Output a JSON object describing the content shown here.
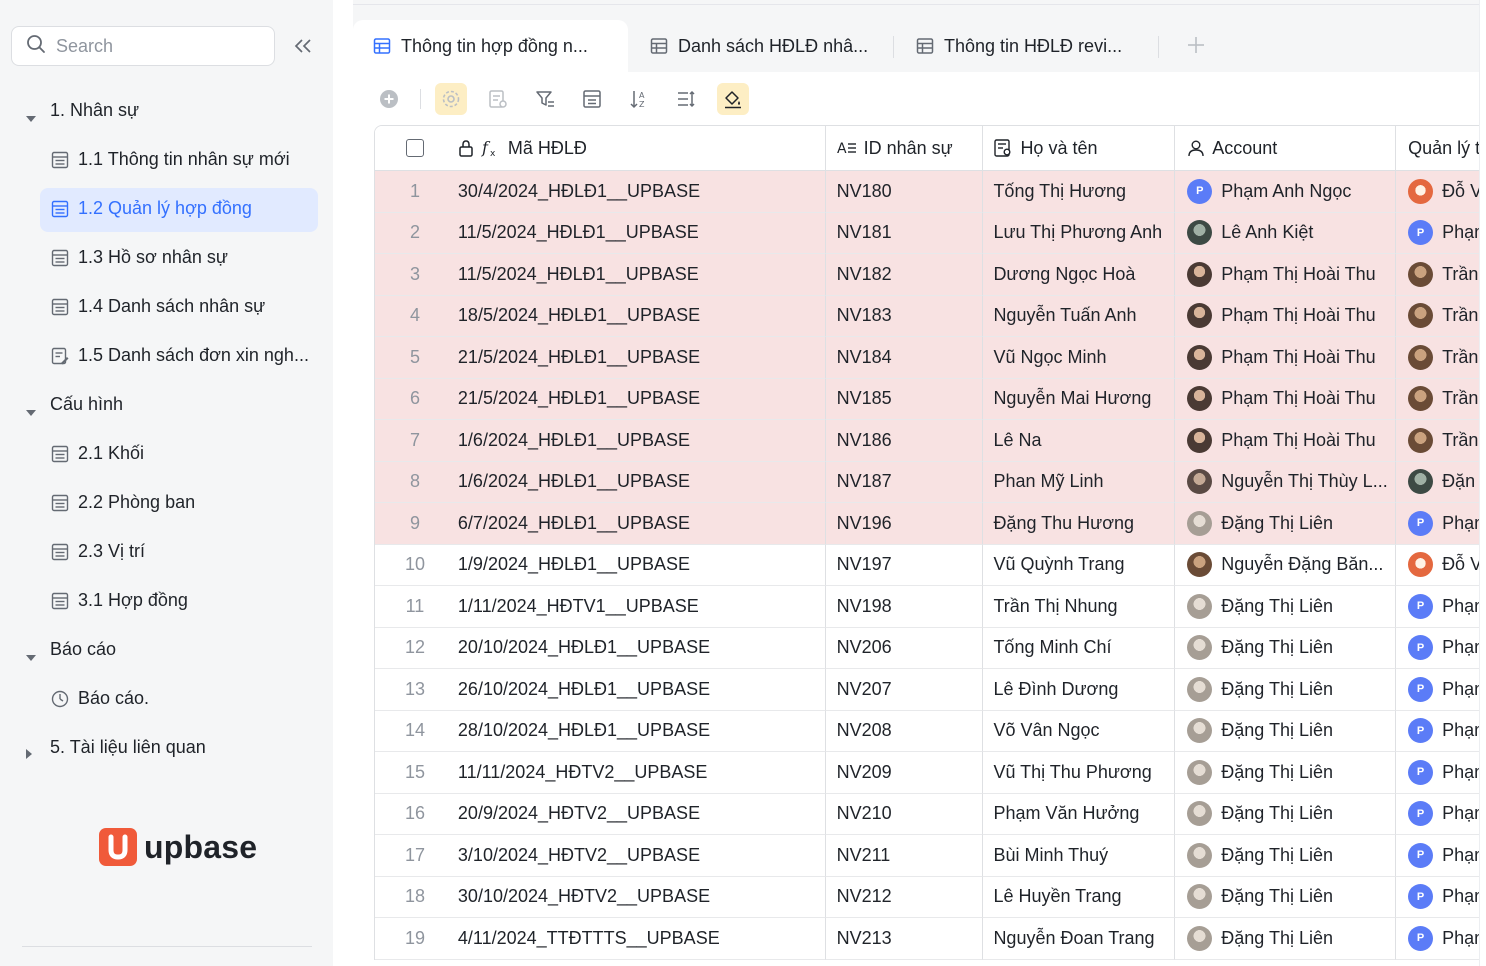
{
  "sidebar": {
    "search_placeholder": "Search",
    "groups": [
      {
        "label": "1. Nhân sự",
        "items": [
          {
            "label": "1.1 Thông tin nhân sự mới",
            "icon": "table-icon"
          },
          {
            "label": "1.2 Quản lý hợp đồng",
            "icon": "table-icon",
            "active": true
          },
          {
            "label": "1.3 Hồ sơ nhân sự",
            "icon": "table-icon"
          },
          {
            "label": "1.4 Danh sách nhân sự",
            "icon": "table-icon"
          },
          {
            "label": "1.5 Danh sách đơn xin ngh...",
            "icon": "table-edit-icon"
          }
        ]
      },
      {
        "label": "Cấu hình",
        "items": [
          {
            "label": "2.1 Khối"
          },
          {
            "label": "2.2 Phòng ban"
          },
          {
            "label": "2.3 Vị trí"
          },
          {
            "label": "3.1 Hợp đồng"
          }
        ]
      },
      {
        "label": "Báo cáo",
        "items": [
          {
            "label": "Báo cáo.",
            "icon": "dashboard-icon"
          }
        ]
      },
      {
        "label": "5. Tài liệu liên quan",
        "items": []
      }
    ],
    "brand": "upbase"
  },
  "tabs": [
    {
      "label": "Thông tin hợp đồng n...",
      "active": true
    },
    {
      "label": "Danh sách HĐLĐ nhâ..."
    },
    {
      "label": "Thông tin HĐLĐ revi..."
    }
  ],
  "colors": {
    "accent": "#3370ff",
    "highlight_row": "#f8e2e2",
    "brand": "#f05a3a"
  },
  "table": {
    "columns": [
      "Mã HĐLĐ",
      "ID nhân sự",
      "Họ và tên",
      "Account",
      "Quản lý t"
    ],
    "rows": [
      {
        "n": "1",
        "ma": "30/4/2024_HĐLĐ1__UPBASE",
        "id": "NV180",
        "name": "Tống Thị Hương",
        "account": "Phạm Anh Ngọc",
        "acc_av": "P",
        "ql": "Đỗ V",
        "ql_av": "orange",
        "red": true
      },
      {
        "n": "2",
        "ma": "11/5/2024_HĐLĐ1__UPBASE",
        "id": "NV181",
        "name": "Lưu Thị Phương Anh",
        "account": "Lê Anh Kiệt",
        "acc_av": "kiet",
        "ql": "Phạm",
        "ql_av": "P",
        "red": true
      },
      {
        "n": "3",
        "ma": "11/5/2024_HĐLĐ1__UPBASE",
        "id": "NV182",
        "name": "Dương Ngọc Hoà",
        "account": "Phạm Thị Hoài Thu",
        "acc_av": "photo",
        "ql": "Trần",
        "ql_av": "brown",
        "red": true
      },
      {
        "n": "4",
        "ma": "18/5/2024_HĐLĐ1__UPBASE",
        "id": "NV183",
        "name": "Nguyễn Tuấn Anh",
        "account": "Phạm Thị Hoài Thu",
        "acc_av": "photo",
        "ql": "Trần",
        "ql_av": "brown",
        "red": true
      },
      {
        "n": "5",
        "ma": "21/5/2024_HĐLĐ1__UPBASE",
        "id": "NV184",
        "name": "Vũ Ngọc Minh",
        "account": "Phạm Thị Hoài Thu",
        "acc_av": "photo",
        "ql": "Trần",
        "ql_av": "brown",
        "red": true
      },
      {
        "n": "6",
        "ma": "21/5/2024_HĐLĐ1__UPBASE",
        "id": "NV185",
        "name": "Nguyễn Mai Hương",
        "account": "Phạm Thị Hoài Thu",
        "acc_av": "photo",
        "ql": "Trần",
        "ql_av": "brown",
        "red": true
      },
      {
        "n": "7",
        "ma": "1/6/2024_HĐLĐ1__UPBASE",
        "id": "NV186",
        "name": "Lê Na",
        "account": "Phạm Thị Hoài Thu",
        "acc_av": "photo",
        "ql": "Trần",
        "ql_av": "brown",
        "red": true
      },
      {
        "n": "8",
        "ma": "1/6/2024_HĐLĐ1__UPBASE",
        "id": "NV187",
        "name": "Phan Mỹ Linh",
        "account": "Nguyễn Thị Thùy L...",
        "acc_av": "dark2",
        "ql": "Đặn",
        "ql_av": "kiet",
        "red": true
      },
      {
        "n": "9",
        "ma": "6/7/2024_HĐLĐ1__UPBASE",
        "id": "NV196",
        "name": "Đặng Thu Hương",
        "account": "Đặng Thị Liên",
        "acc_av": "gray",
        "ql": "Phạm",
        "ql_av": "P",
        "red": true
      },
      {
        "n": "10",
        "ma": "1/9/2024_HĐLĐ1__UPBASE",
        "id": "NV197",
        "name": "Vũ Quỳnh Trang",
        "account": "Nguyễn Đặng Băn...",
        "acc_av": "brown",
        "ql": "Đỗ V",
        "ql_av": "orange",
        "red": false
      },
      {
        "n": "11",
        "ma": "1/11/2024_HĐTV1__UPBASE",
        "id": "NV198",
        "name": "Trần Thị Nhung",
        "account": "Đặng Thị Liên",
        "acc_av": "gray",
        "ql": "Phạm",
        "ql_av": "P",
        "red": false
      },
      {
        "n": "12",
        "ma": "20/10/2024_HĐLĐ1__UPBASE",
        "id": "NV206",
        "name": "Tống Minh Chí",
        "account": "Đặng Thị Liên",
        "acc_av": "gray",
        "ql": "Phạm",
        "ql_av": "P",
        "red": false
      },
      {
        "n": "13",
        "ma": "26/10/2024_HĐLĐ1__UPBASE",
        "id": "NV207",
        "name": "Lê Đình Dương",
        "account": "Đặng Thị Liên",
        "acc_av": "gray",
        "ql": "Phạm",
        "ql_av": "P",
        "red": false
      },
      {
        "n": "14",
        "ma": "28/10/2024_HĐLĐ1__UPBASE",
        "id": "NV208",
        "name": "Võ Vân Ngọc",
        "account": "Đặng Thị Liên",
        "acc_av": "gray",
        "ql": "Phạm",
        "ql_av": "P",
        "red": false
      },
      {
        "n": "15",
        "ma": "11/11/2024_HĐTV2__UPBASE",
        "id": "NV209",
        "name": "Vũ Thị Thu Phương",
        "account": "Đặng Thị Liên",
        "acc_av": "gray",
        "ql": "Phạm",
        "ql_av": "P",
        "red": false
      },
      {
        "n": "16",
        "ma": "20/9/2024_HĐTV2__UPBASE",
        "id": "NV210",
        "name": "Phạm Văn Hưởng",
        "account": "Đặng Thị Liên",
        "acc_av": "gray",
        "ql": "Phạm",
        "ql_av": "P",
        "red": false
      },
      {
        "n": "17",
        "ma": "3/10/2024_HĐTV2__UPBASE",
        "id": "NV211",
        "name": "Bùi Minh Thuý",
        "account": "Đặng Thị Liên",
        "acc_av": "gray",
        "ql": "Phạm",
        "ql_av": "P",
        "red": false
      },
      {
        "n": "18",
        "ma": "30/10/2024_HĐTV2__UPBASE",
        "id": "NV212",
        "name": "Lê Huyền Trang",
        "account": "Đặng Thị Liên",
        "acc_av": "gray",
        "ql": "Phạm",
        "ql_av": "P",
        "red": false
      },
      {
        "n": "19",
        "ma": "4/11/2024_TTĐTTTS__UPBASE",
        "id": "NV213",
        "name": "Nguyễn Đoan Trang",
        "account": "Đặng Thị Liên",
        "acc_av": "gray",
        "ql": "Phạm",
        "ql_av": "P",
        "red": false
      }
    ]
  }
}
